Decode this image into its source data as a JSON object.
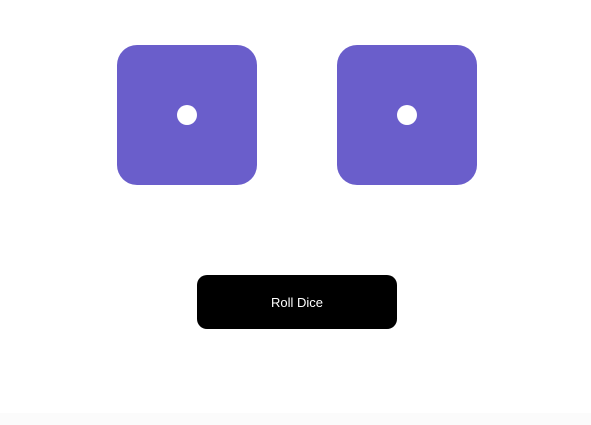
{
  "dice": [
    {
      "value": 1,
      "color": "#6a5ecb",
      "pip_color": "#ffffff"
    },
    {
      "value": 1,
      "color": "#6a5ecb",
      "pip_color": "#ffffff"
    }
  ],
  "roll_button": {
    "label": "Roll Dice",
    "background": "#000000",
    "text_color": "#ffffff"
  }
}
